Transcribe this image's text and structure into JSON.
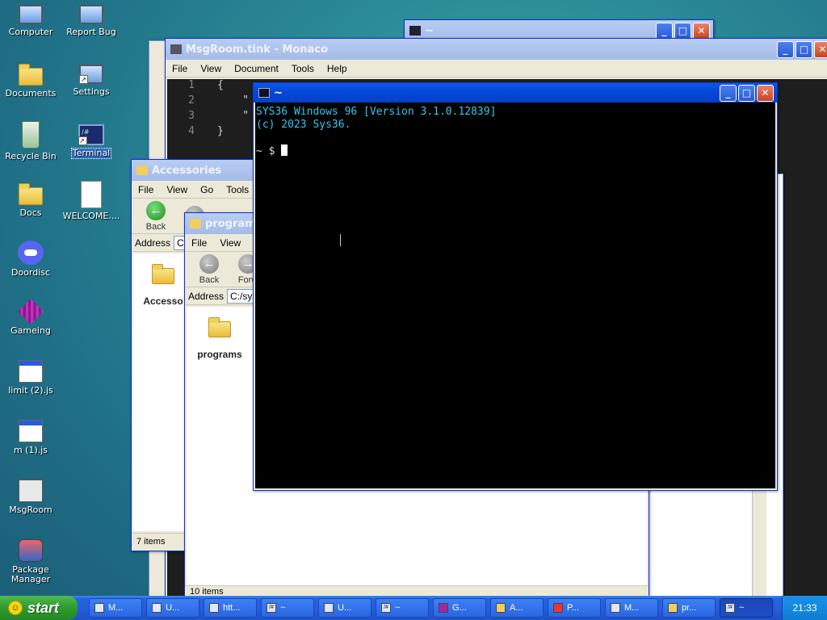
{
  "desktop": {
    "icons": [
      {
        "label": "Computer",
        "icon": "computer-icon"
      },
      {
        "label": "Report Bug",
        "icon": "report-bug-icon"
      },
      {
        "label": "Documents",
        "icon": "documents-icon"
      },
      {
        "label": "Settings",
        "icon": "settings-icon"
      },
      {
        "label": "Recycle Bin",
        "icon": "recycle-bin-icon"
      },
      {
        "label": "Terminal",
        "icon": "terminal-icon"
      },
      {
        "label": "Docs",
        "icon": "folder-icon"
      },
      {
        "label": "WELCOME....",
        "icon": "markdown-file-icon"
      },
      {
        "label": "Doordisc",
        "icon": "discord-icon"
      },
      {
        "label": "Gameing",
        "icon": "game-cube-icon"
      },
      {
        "label": "limit (2).js",
        "icon": "js-file-icon"
      },
      {
        "label": "m (1).js",
        "icon": "js-file-icon"
      },
      {
        "label": "MsgRoom",
        "icon": "msgroom-icon"
      },
      {
        "label": "Package Manager",
        "icon": "package-manager-icon"
      }
    ]
  },
  "windows": {
    "back_window": {
      "title": "~"
    },
    "monaco": {
      "title": "MsgRoom.tink - Monaco",
      "menu": [
        "File",
        "View",
        "Document",
        "Tools",
        "Help"
      ],
      "lines": [
        {
          "num": "1",
          "text": "{"
        },
        {
          "num": "2",
          "text": "    \""
        },
        {
          "num": "3",
          "text": "    \""
        },
        {
          "num": "4",
          "text": "}"
        }
      ]
    },
    "accessories": {
      "title": "Accessories",
      "menu": [
        "File",
        "View",
        "Go",
        "Tools"
      ],
      "back_label": "Back",
      "address_label": "Address",
      "address_value": "C",
      "folder_label": "Accesso",
      "status": "7 items"
    },
    "programs": {
      "title": "programs",
      "menu": [
        "File",
        "View"
      ],
      "back_label": "Back",
      "forward_label": "Forw",
      "address_label": "Address",
      "address_value": "C:/sys",
      "folder_label": "programs",
      "status": "10 items"
    },
    "terminal": {
      "title": "~",
      "line1": "SYS36 Windows 96 [Version 3.1.0.12839]",
      "line2": "(c) 2023 Sys36.",
      "prompt": "~ $"
    }
  },
  "taskbar": {
    "start_label": "start",
    "tasks": [
      {
        "label": "M...",
        "icon": "monaco-icon"
      },
      {
        "label": "U...",
        "icon": "settings-icon"
      },
      {
        "label": "htt...",
        "icon": "browser-icon"
      },
      {
        "label": "~",
        "icon": "terminal-icon"
      },
      {
        "label": "U...",
        "icon": "app-icon"
      },
      {
        "label": "~",
        "icon": "terminal-icon"
      },
      {
        "label": "G...",
        "icon": "game-cube-icon"
      },
      {
        "label": "A...",
        "icon": "folder-icon"
      },
      {
        "label": "P...",
        "icon": "pdf-icon"
      },
      {
        "label": "M...",
        "icon": "msgroom-icon"
      },
      {
        "label": "pr...",
        "icon": "folder-icon"
      },
      {
        "label": "~",
        "icon": "terminal-icon"
      }
    ],
    "clock": "21:33"
  }
}
